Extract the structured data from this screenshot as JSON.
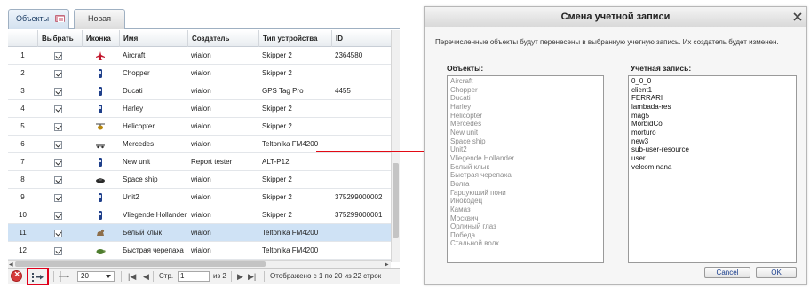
{
  "tabs": [
    {
      "label": "Объекты"
    },
    {
      "label": "Новая"
    }
  ],
  "table": {
    "columns": [
      "Выбрать",
      "Иконка",
      "Имя",
      "Создатель",
      "Тип устройства",
      "ID"
    ],
    "rows": [
      {
        "num": "1",
        "name": "Aircraft",
        "creator": "wialon",
        "device": "Skipper 2",
        "id": "2364580",
        "icon": "aircraft-icon"
      },
      {
        "num": "2",
        "name": "Chopper",
        "creator": "wialon",
        "device": "Skipper 2",
        "id": "",
        "icon": "scooter-icon"
      },
      {
        "num": "3",
        "name": "Ducati",
        "creator": "wialon",
        "device": "GPS Tag Pro",
        "id": "4455",
        "icon": "scooter-icon"
      },
      {
        "num": "4",
        "name": "Harley",
        "creator": "wialon",
        "device": "Skipper 2",
        "id": "",
        "icon": "scooter-icon"
      },
      {
        "num": "5",
        "name": "Helicopter",
        "creator": "wialon",
        "device": "Skipper 2",
        "id": "",
        "icon": "helicopter-icon"
      },
      {
        "num": "6",
        "name": "Mercedes",
        "creator": "wialon",
        "device": "Teltonika FM4200",
        "id": "",
        "icon": "car-icon"
      },
      {
        "num": "7",
        "name": "New unit",
        "creator": "Report tester",
        "device": "ALT-P12",
        "id": "",
        "icon": "scooter-icon"
      },
      {
        "num": "8",
        "name": "Space ship",
        "creator": "wialon",
        "device": "Skipper 2",
        "id": "",
        "icon": "spaceship-icon"
      },
      {
        "num": "9",
        "name": "Unit2",
        "creator": "wialon",
        "device": "Skipper 2",
        "id": "375299000002",
        "icon": "scooter-icon"
      },
      {
        "num": "10",
        "name": "Vliegende Hollander",
        "creator": "wialon",
        "device": "Skipper 2",
        "id": "375299000001",
        "icon": "scooter-icon"
      },
      {
        "num": "11",
        "name": "Белый клык",
        "creator": "wialon",
        "device": "Teltonika FM4200",
        "id": "",
        "icon": "dog-icon"
      },
      {
        "num": "12",
        "name": "Быстрая черепаха",
        "creator": "wialon",
        "device": "Teltonika FM4200",
        "id": "",
        "icon": "turtle-icon"
      }
    ]
  },
  "footer": {
    "page_size": "20",
    "page_label": "Стр.",
    "page_value": "1",
    "of_label": "из 2",
    "status": "Отображено с 1 по 20 из 22 строк"
  },
  "dialog": {
    "title": "Смена учетной записи",
    "description": "Перечисленные объекты будут перенесены в выбранную учетную запись. Их создатель будет изменен.",
    "objects_label": "Объекты:",
    "account_label": "Учетная запись:",
    "objects": [
      "Aircraft",
      "Chopper",
      "Ducati",
      "Harley",
      "Helicopter",
      "Mercedes",
      "New unit",
      "Space ship",
      "Unit2",
      "Vliegende Hollander",
      "Белый клык",
      "Быстрая черепаха",
      "Волга",
      "Гарцующий пони",
      "Инокодец",
      "Камаз",
      "Москвич",
      "Орлиный глаз",
      "Победа",
      "Стальной волк"
    ],
    "accounts": [
      "0_0_0",
      "client1",
      "FERRARI",
      "lambada-res",
      "mag5",
      "MorbidCo",
      "morturo",
      "new3",
      "sub-user-resource",
      "user",
      "velcom.nana"
    ],
    "cancel_label": "Cancel",
    "ok_label": "OK"
  },
  "colors": {
    "selected_row": "#cfe2f5",
    "highlight_box": "#e0001b",
    "arrow": "#e30a14"
  }
}
